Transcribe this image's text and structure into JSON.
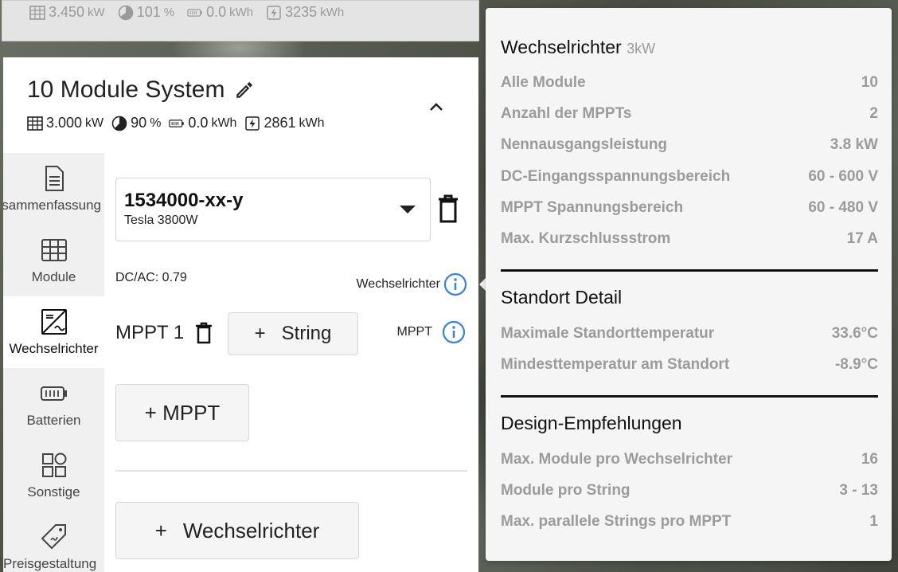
{
  "top_strip": {
    "power": "3.450",
    "power_unit": "kW",
    "ratio": "101",
    "ratio_unit": "%",
    "battery": "0.0",
    "battery_unit": "kWh",
    "energy": "3235",
    "energy_unit": "kWh"
  },
  "system": {
    "title": "10 Module System",
    "power": "3.000",
    "power_unit": "kW",
    "ratio": "90",
    "ratio_unit": "%",
    "battery": "0.0",
    "battery_unit": "kWh",
    "energy": "2861",
    "energy_unit": "kWh"
  },
  "sidenav": {
    "items": [
      {
        "label": "Zusammenfassung",
        "icon": "document-icon"
      },
      {
        "label": "Module",
        "icon": "grid-icon"
      },
      {
        "label": "Wechselrichter",
        "icon": "inverter-icon"
      },
      {
        "label": "Batterien",
        "icon": "battery-icon"
      },
      {
        "label": "Sonstige",
        "icon": "apps-icon"
      },
      {
        "label": "Preisgestaltung",
        "icon": "price-tag-icon"
      }
    ]
  },
  "inverter": {
    "model": "1534000-xx-y",
    "name": "Tesla 3800W",
    "dcac": "DC/AC: 0.79",
    "info_label": "Wechselrichter"
  },
  "mppt": {
    "label": "MPPT 1",
    "string_plus": "+",
    "string_label": "String",
    "info_label": "MPPT",
    "add_label": "+ MPPT"
  },
  "add_inverter": {
    "plus": "+",
    "label": "Wechselrichter"
  },
  "tooltip": {
    "inverter_title": "Wechselrichter",
    "inverter_sub": "3kW",
    "inverter_rows": [
      {
        "label": "Alle Module",
        "value": "10"
      },
      {
        "label": "Anzahl der MPPTs",
        "value": "2"
      },
      {
        "label": "Nennausgangsleistung",
        "value": "3.8 kW"
      },
      {
        "label": "DC-Eingangsspannungsbereich",
        "value": "60 - 600 V"
      },
      {
        "label": "MPPT Spannungsbereich",
        "value": "60 - 480 V"
      },
      {
        "label": "Max. Kurzschlussstrom",
        "value": "17 A"
      }
    ],
    "site_title": "Standort Detail",
    "site_rows": [
      {
        "label": "Maximale Standorttemperatur",
        "value": "33.6°C"
      },
      {
        "label": "Mindesttemperatur am Standort",
        "value": "-8.9°C"
      }
    ],
    "design_title": "Design-Empfehlungen",
    "design_rows": [
      {
        "label": "Max. Module pro Wechselrichter",
        "value": "16"
      },
      {
        "label": "Module pro String",
        "value": "3 - 13"
      },
      {
        "label": "Max. parallele Strings pro MPPT",
        "value": "1"
      }
    ]
  }
}
